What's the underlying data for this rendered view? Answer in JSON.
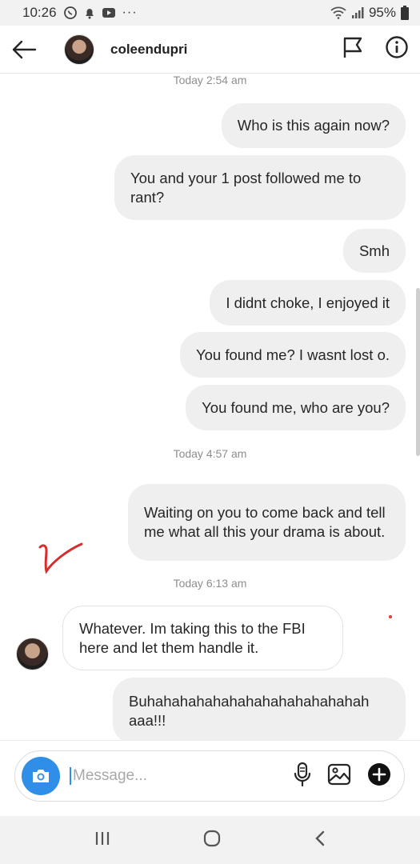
{
  "status_bar": {
    "time": "10:26",
    "battery": "95%",
    "overflow": "···"
  },
  "header": {
    "username": "coleendupri"
  },
  "messages": [
    {
      "type": "timestamp",
      "text": "Today 2:54 am"
    },
    {
      "type": "outgoing",
      "text": "Who is this again now?"
    },
    {
      "type": "outgoing",
      "text": "You and your 1 post followed me to rant?"
    },
    {
      "type": "outgoing",
      "text": "Smh"
    },
    {
      "type": "outgoing",
      "text": "I didnt choke, I enjoyed it"
    },
    {
      "type": "outgoing",
      "text": "You found me? I wasnt lost o."
    },
    {
      "type": "outgoing",
      "text": "You found me, who are you?"
    },
    {
      "type": "timestamp",
      "text": "Today 4:57 am"
    },
    {
      "type": "outgoing",
      "text": "Waiting on you to come back and tell me what all this your drama is about."
    },
    {
      "type": "timestamp",
      "text": "Today 6:13 am"
    },
    {
      "type": "incoming",
      "text": "Whatever. Im taking this to the FBI here and let them handle it."
    },
    {
      "type": "outgoing",
      "text": "Buhahahahahahahahahahahahahah aaa!!!"
    }
  ],
  "composer": {
    "placeholder": "Message..."
  },
  "colors": {
    "accent": "#2f8fe8",
    "outgoing_bubble": "#efefef",
    "annotation": "#d32f2f"
  },
  "icons": {
    "back": "arrow-left-icon",
    "flag": "flag-icon",
    "info": "info-icon",
    "camera": "camera-icon",
    "mic": "microphone-icon",
    "gallery": "image-icon",
    "add": "plus-circle-icon"
  }
}
